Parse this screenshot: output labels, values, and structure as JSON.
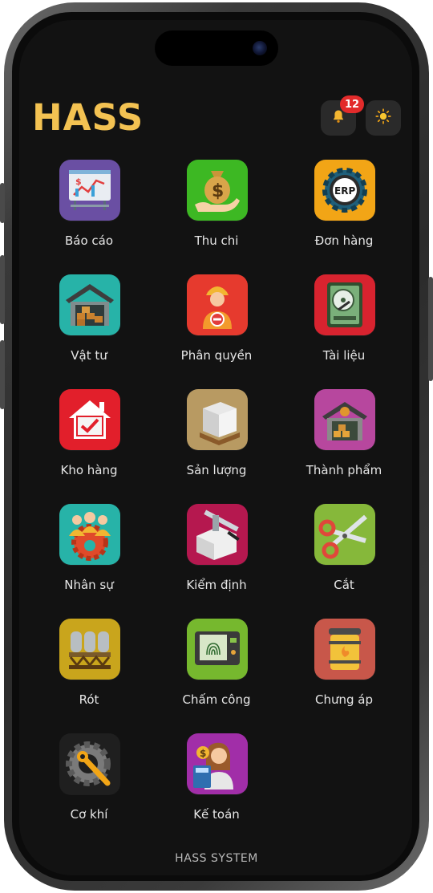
{
  "header": {
    "logo_text": "HASS",
    "notification_count": "12"
  },
  "menu": [
    {
      "label": "Báo cáo",
      "icon": "report-chart-icon",
      "color": "#6a4fa3"
    },
    {
      "label": "Thu chi",
      "icon": "money-bag-hand-icon",
      "color": "#3db823"
    },
    {
      "label": "Đơn hàng",
      "icon": "erp-gear-icon",
      "color": "#f2a516"
    },
    {
      "label": "Vật tư",
      "icon": "warehouse-icon",
      "color": "#27b3a8"
    },
    {
      "label": "Phân quyền",
      "icon": "worker-permission-icon",
      "color": "#e63a2e"
    },
    {
      "label": "Tài liệu",
      "icon": "hard-drive-icon",
      "color": "#d8232f"
    },
    {
      "label": "Kho hàng",
      "icon": "house-check-icon",
      "color": "#e21f2b"
    },
    {
      "label": "Sản lượng",
      "icon": "pallet-boxes-icon",
      "color": "#b89a62"
    },
    {
      "label": "Thành phẩm",
      "icon": "factory-boxes-icon",
      "color": "#b7479e"
    },
    {
      "label": "Nhân sự",
      "icon": "team-gear-icon",
      "color": "#27b3a8"
    },
    {
      "label": "Kiểm định",
      "icon": "caliper-inspection-icon",
      "color": "#b5184f"
    },
    {
      "label": "Cắt",
      "icon": "scissors-icon",
      "color": "#86b83a"
    },
    {
      "label": "Rót",
      "icon": "silo-tanks-icon",
      "color": "#c9a51c"
    },
    {
      "label": "Chấm công",
      "icon": "fingerprint-device-icon",
      "color": "#76b82e"
    },
    {
      "label": "Chưng áp",
      "icon": "autoclave-icon",
      "color": "#c8574a"
    },
    {
      "label": "Cơ khí",
      "icon": "gear-wrench-icon",
      "color": "#1f1f1f"
    },
    {
      "label": "Kế toán",
      "icon": "accountant-icon",
      "color": "#a12ea8"
    }
  ],
  "footer": {
    "text": "HASS SYSTEM"
  }
}
